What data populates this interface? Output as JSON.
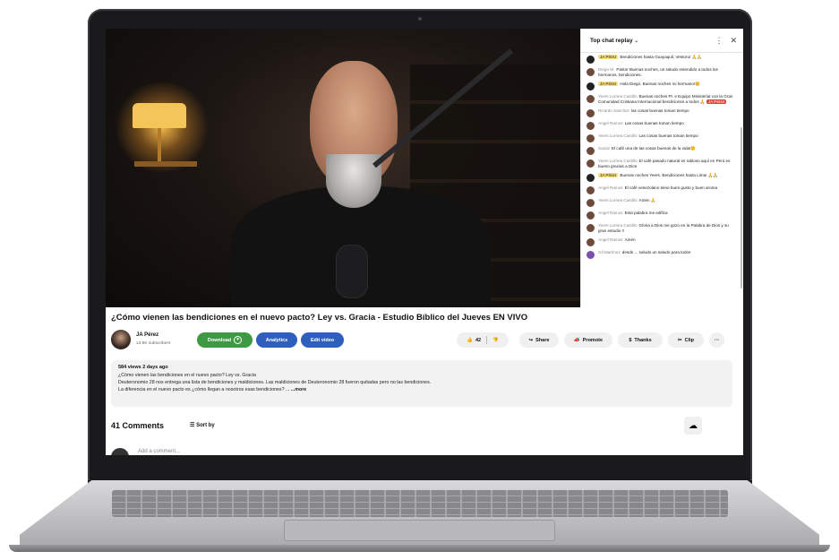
{
  "chat": {
    "header": "Top chat replay",
    "more_icon": "⋮",
    "close_icon": "✕",
    "messages": [
      {
        "author": "JA Pérez",
        "owner": true,
        "text": "Bendiciones hasta Guayaquil, Vestoruí 🙏🙏"
      },
      {
        "author": "Diego M.",
        "owner": false,
        "text": "Pastor Buenas noches, un saludo extendido a todos los hermanos, bendiciones."
      },
      {
        "author": "JA Pérez",
        "owner": true,
        "text": "Hola Diego. Buenas noches mi hermano!😊"
      },
      {
        "author": "Yeers Lurnea Castillo",
        "owner": false,
        "badge": "JA Pérez",
        "text": "Buenas noches Pr. e Equipo Ministerial con la Gran Comunidad Cristiana Internacional bendiciones a todos 🙏"
      },
      {
        "author": "Ricardo Sánchez",
        "owner": false,
        "text": "las cosas buenas toman tiempo"
      },
      {
        "author": "Angel Ramos",
        "owner": false,
        "text": "Las cosas buenas toman tiempo"
      },
      {
        "author": "Yeers Lurnea Castillo",
        "owner": false,
        "text": "Las cosas buenas toman tiempo"
      },
      {
        "author": "Saraiz",
        "owner": false,
        "text": "El café una de las cosas buenas de la vida!😊"
      },
      {
        "author": "Yeers Lurnea Castillo",
        "owner": false,
        "text": "El café pasado natural es rabioso aquí en Perú es bueno gracias a Dios"
      },
      {
        "author": "JA Pérez",
        "owner": true,
        "text": "Buenas noches Yeers. Bendiciones hasta Lima! 🙏🙏"
      },
      {
        "author": "Angel Ramos",
        "owner": false,
        "text": "El café venezolano tiene buen gusto y buen aroma"
      },
      {
        "author": "Yeers Lurnea Castillo",
        "owner": false,
        "text": "Amén 🙏"
      },
      {
        "author": "Angel Ramos",
        "owner": false,
        "text": "Esta palabra me edifica"
      },
      {
        "author": "Yeers Lurnea Castillo",
        "owner": false,
        "text": "Gloria a Dios me gozo en la Palabra de Dios y su gran estudio !!"
      },
      {
        "author": "Angel Ramos",
        "owner": false,
        "text": "Amén"
      },
      {
        "author": "Gil Martínez",
        "owner": false,
        "text": "desde ... saludo un saludo para todos"
      }
    ]
  },
  "video": {
    "title": "¿Cómo vienen las bendiciones en el nuevo pacto? Ley vs. Gracia - Estudio Bíblico del Jueves EN VIVO"
  },
  "channel": {
    "name": "JA Pérez",
    "subscribers": "13.9K subscribers"
  },
  "buttons": {
    "download": "Download",
    "analytics": "Analytics",
    "edit": "Edit video",
    "likes": "42",
    "share": "Share",
    "promote": "Promote",
    "thanks": "Thanks",
    "clip": "Clip",
    "more": "···"
  },
  "description": {
    "meta": "584 views  2 days ago",
    "line1": "¿Cómo vienen las bendiciones en el nuevo pacto? Ley vs. Gracia",
    "line2": "Deuteronomio 28 nos entrega una lista de bendiciones y maldiciones. Las maldiciones de Deuteronomio 28 fueron quitadas pero no las bendiciones.",
    "line3": "La diferencia en el nuevo pacto es ¿cómo llegan a nosotros esas bendiciones? ...",
    "more": "...more"
  },
  "comments": {
    "count": "41 Comments",
    "sort": "Sort by",
    "add_placeholder": "Add a comment..."
  },
  "colors": {
    "download_green": "#3d9a43",
    "action_blue": "#2f5fbd",
    "owner_highlight": "#f7e078",
    "badge_red": "#e0443a"
  }
}
